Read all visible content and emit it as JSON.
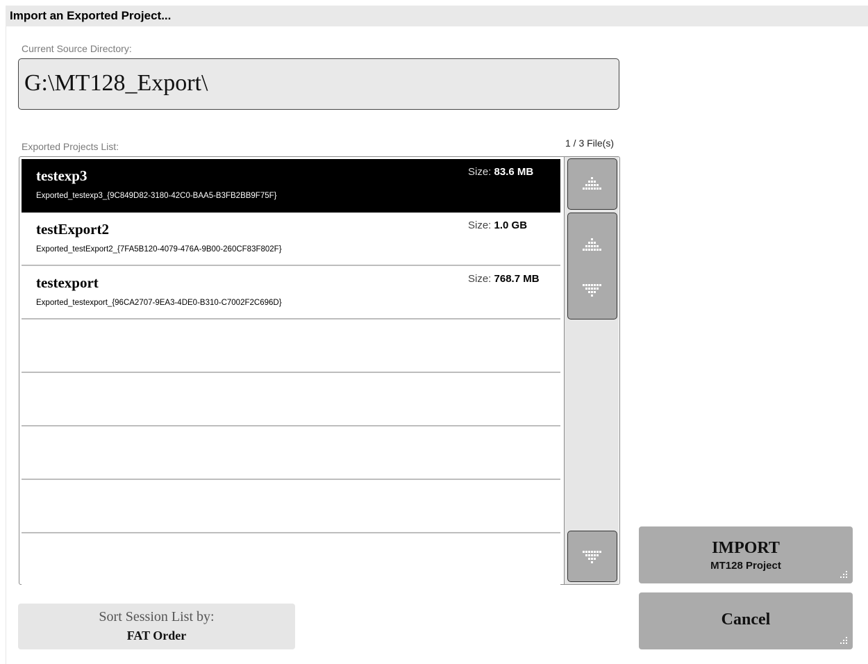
{
  "window": {
    "title": "Import an Exported Project..."
  },
  "source": {
    "label": "Current Source Directory:",
    "path": "G:\\MT128_Export\\"
  },
  "list": {
    "label": "Exported Projects List:",
    "count": "1 / 3 File(s)",
    "size_label": "Size:",
    "items": [
      {
        "name": "testexp3",
        "file": "Exported_testexp3_{9C849D82-3180-42C0-BAA5-B3FB2BB9F75F}",
        "size": "83.6 MB",
        "selected": true
      },
      {
        "name": "testExport2",
        "file": "Exported_testExport2_{7FA5B120-4079-476A-9B00-260CF83F802F}",
        "size": "1.0 GB",
        "selected": false
      },
      {
        "name": "testexport",
        "file": "Exported_testexport_{96CA2707-9EA3-4DE0-B310-C7002F2C696D}",
        "size": "768.7 MB",
        "selected": false
      }
    ],
    "scroll_icons": [
      "arrow-up-icon",
      "arrow-up-icon",
      "arrow-down-icon",
      "arrow-down-icon"
    ]
  },
  "sort": {
    "line1": "Sort Session List by:",
    "line2": "FAT Order"
  },
  "import_button": {
    "line1": "IMPORT",
    "line2": "MT128 Project"
  },
  "cancel_button": {
    "label": "Cancel"
  },
  "colors": {
    "selected_row": "#000000",
    "button_gray": "#ababab",
    "panel_gray": "#e6e6e6"
  }
}
